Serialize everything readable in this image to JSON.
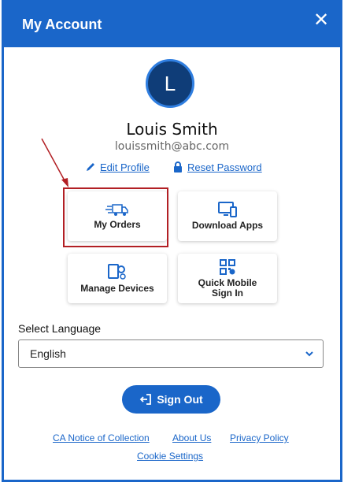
{
  "header": {
    "title": "My Account",
    "close_glyph": "✕"
  },
  "user": {
    "initial": "L",
    "name": "Louis Smith",
    "email": "louissmith@abc.com"
  },
  "profile_links": {
    "edit_profile": "Edit Profile",
    "reset_password": "Reset Password"
  },
  "tiles": [
    {
      "label": "My Orders",
      "icon": "delivery-truck-icon"
    },
    {
      "label": "Download Apps",
      "icon": "devices-icon"
    },
    {
      "label": "Manage Devices",
      "icon": "device-settings-icon"
    },
    {
      "label_line1": "Quick Mobile",
      "label_line2": "Sign In",
      "icon": "qr-code-icon"
    }
  ],
  "language": {
    "label": "Select Language",
    "selected": "English"
  },
  "sign_out": {
    "label": "Sign Out"
  },
  "footer": {
    "ca_notice": "CA Notice of Collection",
    "about_us": "About Us",
    "privacy_policy": "Privacy Policy",
    "cookie_settings": "Cookie Settings"
  },
  "colors": {
    "brand_blue": "#1a66c9",
    "avatar_bg": "#0f3d78",
    "highlight_red": "#b21f24"
  }
}
